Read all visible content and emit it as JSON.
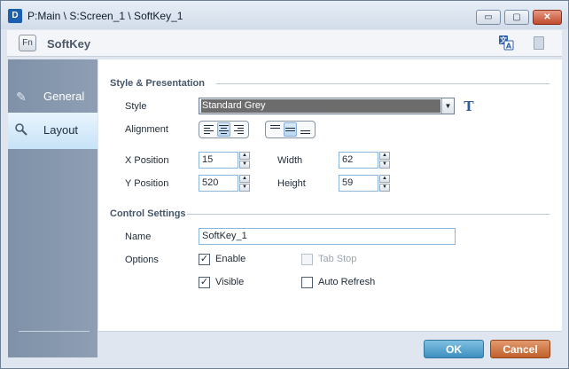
{
  "window": {
    "app_icon": "D",
    "title": "P:Main \\ S:Screen_1 \\ SoftKey_1",
    "controls": {
      "minimize": "▭",
      "maximize": "▢",
      "close": "✕"
    }
  },
  "header": {
    "icon_label": "Fn",
    "title": "SoftKey",
    "icons": [
      "translate-icon",
      "clipboard-icon"
    ]
  },
  "sidebar": {
    "items": [
      {
        "label": "General",
        "icon": "pen-icon",
        "selected": false
      },
      {
        "label": "Layout",
        "icon": "magnifier-icon",
        "selected": true
      }
    ]
  },
  "style_presentation": {
    "section_title": "Style & Presentation",
    "style_label": "Style",
    "style_value": "Standard Grey",
    "alignment_label": "Alignment",
    "horizontal_alignment_selected": "center",
    "vertical_alignment_selected": "middle",
    "x_label": "X Position",
    "x_value": "15",
    "y_label": "Y Position",
    "y_value": "520",
    "width_label": "Width",
    "width_value": "62",
    "height_label": "Height",
    "height_value": "59"
  },
  "control_settings": {
    "section_title": "Control Settings",
    "name_label": "Name",
    "name_value": "SoftKey_1",
    "options_label": "Options",
    "enable_label": "Enable",
    "enable_checked": true,
    "tab_stop_label": "Tab Stop",
    "tab_stop_checked": false,
    "visible_label": "Visible",
    "visible_checked": true,
    "auto_refresh_label": "Auto Refresh",
    "auto_refresh_checked": false
  },
  "footer": {
    "ok_label": "OK",
    "cancel_label": "Cancel"
  },
  "colors": {
    "sidebar": "#8596ac",
    "selected_tab": "#d6ebf9",
    "ok": "#4a9bc9",
    "cancel": "#cc6b36"
  }
}
